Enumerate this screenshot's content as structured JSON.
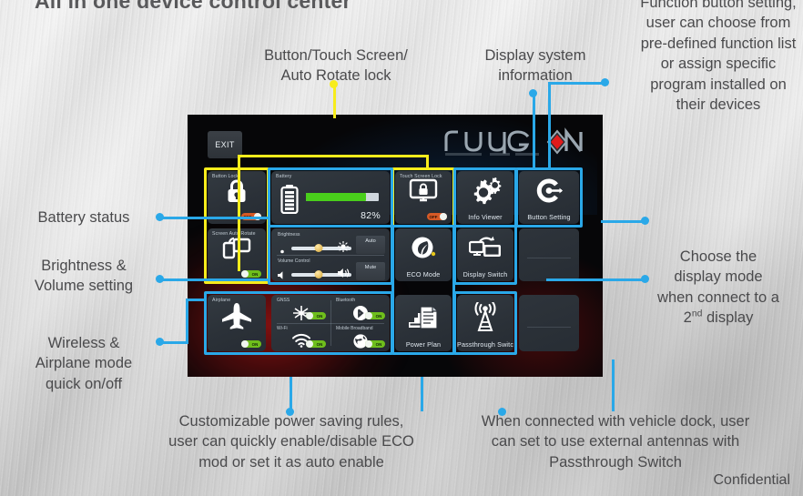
{
  "slide": {
    "title": "All in one device control center",
    "confidential": "Confidential"
  },
  "callouts": {
    "button_touch_rotate_lock": "Button/Touch Screen/\nAuto Rotate lock",
    "display_system_information": "Display system\ninformation",
    "function_button_setting": "Function button setting, user can choose from pre-defined function list or assign specific program installed on their devices",
    "battery_status": "Battery status",
    "brightness_volume_setting": "Brightness &\nVolume setting",
    "wireless_airplane": "Wireless &\nAirplane mode\nquick on/off",
    "display_mode": "Choose the display mode when connect to a 2nd display",
    "display_mode_sup": "nd",
    "eco_power_saving": "Customizable power saving rules, user can quickly enable/disable ECO mod or set it as auto enable",
    "passthrough": "When connected with vehicle dock, user can set to use external antennas with Passthrough Switch"
  },
  "device": {
    "exit_label": "EXIT",
    "brand": "ruggon",
    "tiles": {
      "button_lock": {
        "label": "Button Lock",
        "state": "OFF",
        "icon": "padlock-icon"
      },
      "screen_auto_rotate": {
        "label": "Screen Auto Rotate",
        "state": "ON",
        "icon": "rotate-screen-icon"
      },
      "battery": {
        "label": "Battery",
        "percent": "82%",
        "fill": 82,
        "icon": "battery-icon"
      },
      "brightness": {
        "label": "Brightness",
        "value": 45,
        "button": "Auto",
        "icon": "brightness-icon"
      },
      "volume": {
        "label": "Volume Control",
        "value": 45,
        "button": "Mute",
        "icon": "speaker-icon"
      },
      "airplane": {
        "label": "Airplane",
        "state": "ON",
        "icon": "airplane-icon"
      },
      "gnss": {
        "label": "GNSS",
        "state": "ON",
        "icon": "satellite-icon"
      },
      "bluetooth": {
        "label": "Bluetooth",
        "state": "ON",
        "icon": "bluetooth-icon"
      },
      "wifi": {
        "label": "Wi-Fi",
        "state": "ON",
        "icon": "wifi-icon"
      },
      "mobile_broadband": {
        "label": "Mobile Broadband",
        "state": "ON",
        "icon": "globe-icon"
      },
      "touch_screen_lock": {
        "label": "Touch Screen Lock",
        "state": "OFF",
        "icon": "monitor-lock-icon"
      },
      "eco_mode": {
        "label": "ECO Mode",
        "icon": "leaf-icon"
      },
      "power_plan": {
        "label": "Power Plan",
        "icon": "power-plan-icon"
      },
      "info_viewer": {
        "label": "Info Viewer",
        "icon": "gears-icon"
      },
      "display_switch": {
        "label": "Display Switch",
        "icon": "display-switch-icon"
      },
      "passthrough_switch": {
        "label": "Passthrough Switch",
        "icon": "antenna-icon"
      },
      "button_setting": {
        "label": "Button Setting",
        "icon": "c-target-icon"
      }
    }
  },
  "colors": {
    "accent_blue": "#2aa8e8",
    "accent_yellow": "#f7ec1c",
    "battery_green": "#49cf1b",
    "on_green": "#6fbf1c",
    "off_orange": "#d65a26",
    "logo_red": "#e01b1b"
  }
}
